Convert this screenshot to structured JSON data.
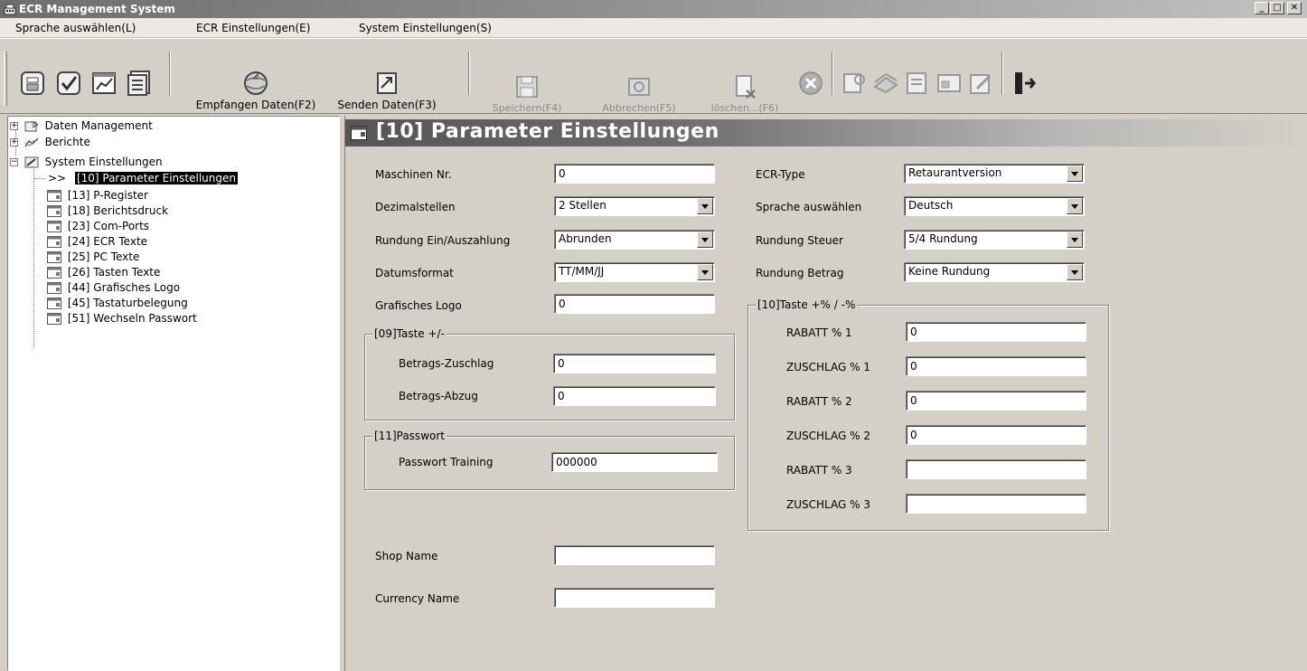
{
  "window": {
    "title": "ECR Management System",
    "buttons": {
      "minimize": "_",
      "maximize": "□",
      "close": "✕"
    }
  },
  "menu": [
    {
      "label": "Sprache auswählen(L)"
    },
    {
      "label": "ECR Einstellungen(E)"
    },
    {
      "label": "System Einstellungen(S)"
    }
  ],
  "toolbar": {
    "receive_label": "Empfangen Daten(F2)",
    "send_label": "Senden Daten(F3)",
    "save_label": "Speichern(F4)",
    "cancel_label": "Abbrechen(F5)",
    "delete_label": "löschen...(F6)"
  },
  "tree": {
    "root_items": [
      {
        "label": "Daten Management",
        "expander": "+"
      },
      {
        "label": "Berichte",
        "expander": "+"
      },
      {
        "label": "System Einstellungen",
        "expander": "−"
      }
    ],
    "selected_marker": ">>",
    "children": [
      {
        "label": "[10] Parameter Einstellungen",
        "selected": true
      },
      {
        "label": "[13] P-Register"
      },
      {
        "label": "[18] Berichtsdruck"
      },
      {
        "label": "[23] Com-Ports"
      },
      {
        "label": "[24] ECR Texte"
      },
      {
        "label": "[25] PC Texte"
      },
      {
        "label": "[26] Tasten Texte"
      },
      {
        "label": "[44] Grafisches Logo"
      },
      {
        "label": "[45] Tastaturbelegung"
      },
      {
        "label": "[51] Wechseln Passwort"
      }
    ]
  },
  "page": {
    "title": "[10] Parameter Einstellungen",
    "left_fields": {
      "machine_no": {
        "label": "Maschinen Nr.",
        "value": "0"
      },
      "decimals": {
        "label": "Dezimalstellen",
        "value": "2 Stellen"
      },
      "rounding_inout": {
        "label": "Rundung Ein/Auszahlung",
        "value": "Abrunden"
      },
      "date_format": {
        "label": "Datumsformat",
        "value": "TT/MM/JJ"
      },
      "graphic_logo": {
        "label": "Grafisches Logo",
        "value": "0"
      }
    },
    "group09": {
      "title": "[09]Taste +/-",
      "surcharge": {
        "label": "Betrags-Zuschlag",
        "value": "0"
      },
      "deduction": {
        "label": "Betrags-Abzug",
        "value": "0"
      }
    },
    "group11": {
      "title": "[11]Passwort",
      "training": {
        "label": "Passwort Training",
        "value": "000000"
      }
    },
    "shop_name": {
      "label": "Shop Name",
      "value": ""
    },
    "currency_name": {
      "label": "Currency Name",
      "value": ""
    },
    "right_fields": {
      "ecr_type": {
        "label": "ECR-Type",
        "value": "Retaurantversion"
      },
      "language": {
        "label": "Sprache auswählen",
        "value": "Deutsch"
      },
      "rounding_tax": {
        "label": "Rundung Steuer",
        "value": "5/4 Rundung"
      },
      "rounding_amount": {
        "label": "Rundung Betrag",
        "value": "Keine Rundung"
      }
    },
    "group10": {
      "title": "[10]Taste +% / -%",
      "rows": [
        {
          "label": "RABATT % 1",
          "value": "0"
        },
        {
          "label": "ZUSCHLAG % 1",
          "value": "0"
        },
        {
          "label": "RABATT % 2",
          "value": "0"
        },
        {
          "label": "ZUSCHLAG % 2",
          "value": "0"
        },
        {
          "label": "RABATT % 3",
          "value": ""
        },
        {
          "label": "ZUSCHLAG % 3",
          "value": ""
        }
      ]
    }
  }
}
